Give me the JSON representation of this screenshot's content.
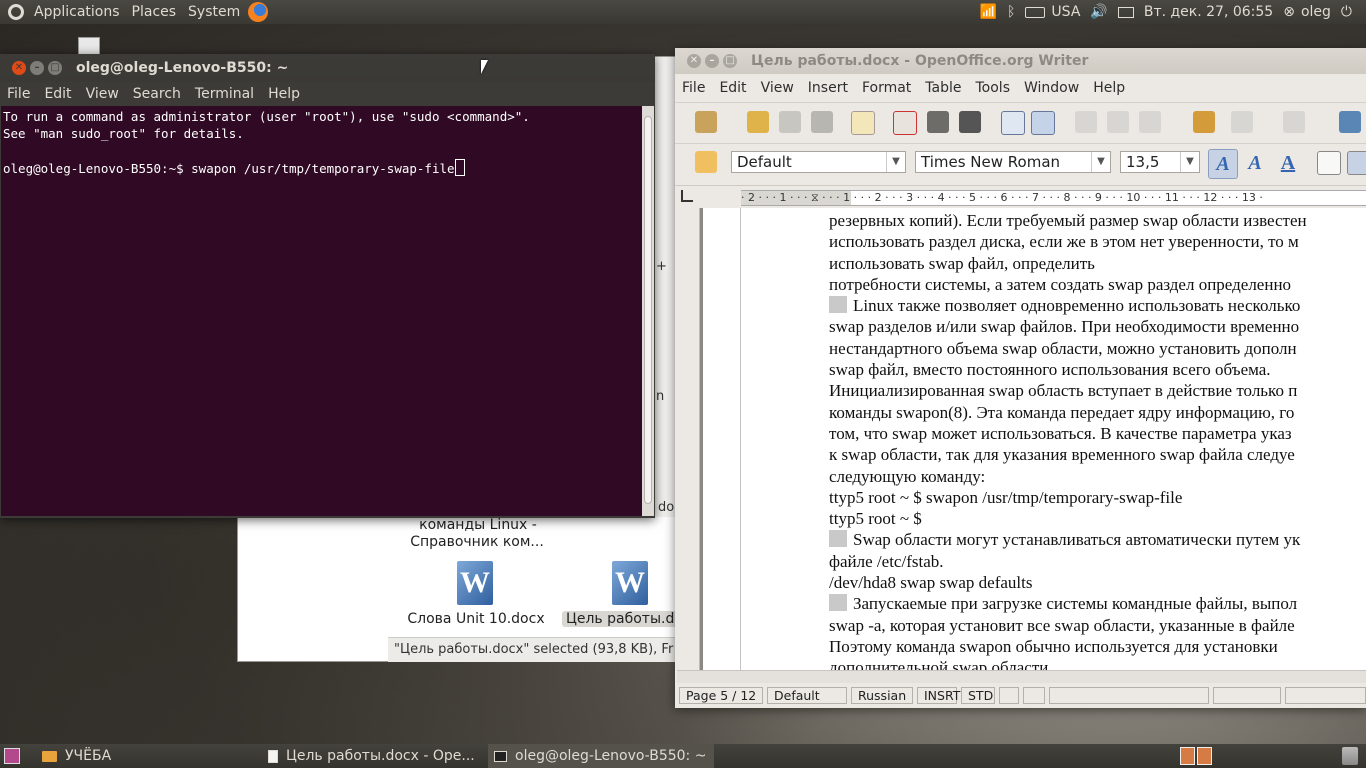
{
  "top_panel": {
    "menus": [
      "Applications",
      "Places",
      "System"
    ],
    "keyboard_layout": "USA",
    "datetime": "Вт. дек. 27, 06:55",
    "user": "oleg"
  },
  "terminal": {
    "title": "oleg@oleg-Lenovo-B550: ~",
    "menu": [
      "File",
      "Edit",
      "View",
      "Search",
      "Terminal",
      "Help"
    ],
    "lines": [
      "To run a command as administrator (user \"root\"), use \"sudo <command>\".",
      "See \"man sudo_root\" for details.",
      "",
      "oleg@oleg-Lenovo-B550:~$ swapon /usr/tmp/temporary-swap-file"
    ]
  },
  "file_manager": {
    "item1_label_l1": "команды Linux -",
    "item1_label_l2": "Справочник ком...",
    "file1": "Слова Unit 10.docx",
    "file2": "Цель работы.docx",
    "status": "\"Цель работы.docx\" selected (93,8 KB), Fr",
    "peek_plus": "+",
    "peek_n": "n",
    "peek_do": "do"
  },
  "writer": {
    "title": "Цель работы.docx - OpenOffice.org Writer",
    "menu": [
      "File",
      "Edit",
      "View",
      "Insert",
      "Format",
      "Table",
      "Tools",
      "Window",
      "Help"
    ],
    "paragraph_style": "Default",
    "font_name": "Times New Roman",
    "font_size": "13,5",
    "ruler_labels": "· 2 · · · 1 · · · ⧖ · · · 1 · · · 2 · · · 3 · · · 4 · · · 5 · · · 6 · · · 7 · · · 8 · · · 9 · · · 10 · · · 11 · · · 12 · · · 13 ·",
    "doc_lines": [
      "резервных копий). Если требуемый размер swap области известен",
      "использовать раздел диска, если же в этом нет уверенности, то м",
      "использовать swap файл, определить",
      "потребности системы, а затем создать swap раздел определенно",
      "Linux также позволяет одновременно использовать несколько",
      "swap разделов и/или swap файлов. При необходимости временно",
      "нестандартного объема swap области, можно установить дополн",
      "swap файл, вместо постоянного использования всего объема.",
      "Инициализированная swap область вступает в действие только п",
      "команды swapon(8). Эта команда передает ядру информацию, го",
      "том, что swap может использоваться. В качестве параметра указ",
      "к swap области, так для указания временного swap файла следуе",
      "следующую команду:",
      "ttyp5 root ~ $ swapon /usr/tmp/temporary-swap-file",
      "ttyp5 root ~ $",
      "Swap области могут устанавливаться автоматически путем ук",
      "файле /etc/fstab.",
      "/dev/hda8 swap swap defaults",
      "Запускаемые при загрузке системы командные файлы, выпол",
      "swap -a, которая установит все swap области, указанные в файле",
      "Поэтому команда swapon обычно используется для установки",
      "дополнительной swap области."
    ],
    "status": {
      "page": "Page 5 / 12",
      "style": "Default",
      "language": "Russian",
      "insert_mode": "INSRT",
      "selection_mode": "STD"
    }
  },
  "taskbar": {
    "tasks": [
      "УЧЁБА",
      "Цель работы.docx - Ope...",
      "oleg@oleg-Lenovo-B550: ~"
    ]
  }
}
